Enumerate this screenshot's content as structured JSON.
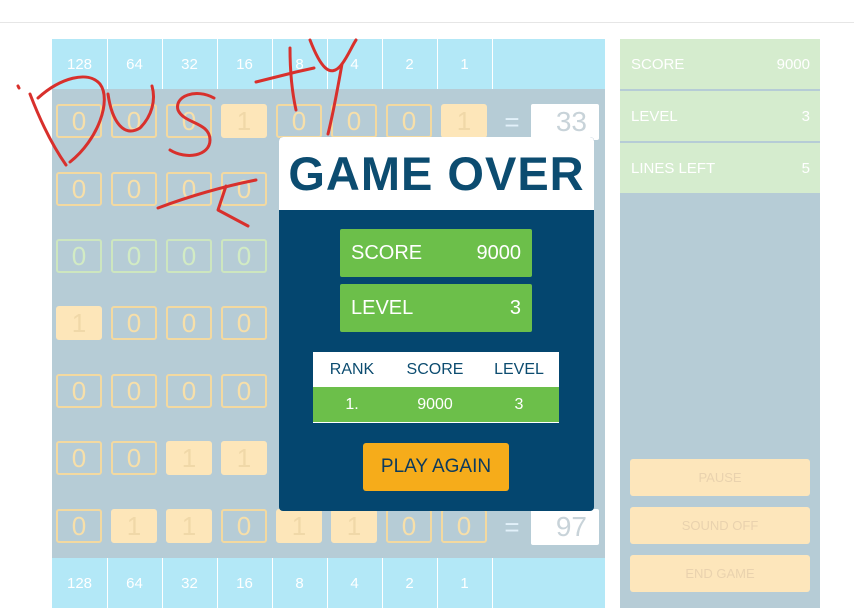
{
  "header_values": [
    "128",
    "64",
    "32",
    "16",
    "8",
    "4",
    "2",
    "1"
  ],
  "footer_values": [
    "128",
    "64",
    "32",
    "16",
    "8",
    "4",
    "2",
    "1"
  ],
  "rows": [
    {
      "bits": [
        "0",
        "0",
        "0",
        "1",
        "0",
        "0",
        "0",
        "1"
      ],
      "eq": "=",
      "answer": "33",
      "on": [
        3,
        7
      ]
    },
    {
      "bits": [
        "0",
        "0",
        "0",
        "0"
      ],
      "eq": "",
      "answer": "",
      "on": []
    },
    {
      "bits": [
        "0",
        "0",
        "0",
        "0"
      ],
      "eq": "",
      "answer": "",
      "on": []
    },
    {
      "bits": [
        "1",
        "0",
        "0",
        "0"
      ],
      "eq": "",
      "answer": "",
      "on": [
        0
      ]
    },
    {
      "bits": [
        "0",
        "0",
        "0",
        "0"
      ],
      "eq": "",
      "answer": "",
      "on": []
    },
    {
      "bits": [
        "0",
        "0",
        "1",
        "1"
      ],
      "eq": "",
      "answer": "",
      "on": [
        2,
        3
      ]
    },
    {
      "bits": [
        "0",
        "1",
        "1",
        "0",
        "1",
        "1",
        "0",
        "0"
      ],
      "eq": "=",
      "answer": "97",
      "on": [
        1,
        2,
        4,
        5
      ]
    }
  ],
  "sidebar": {
    "score_label": "SCORE",
    "score_value": "9000",
    "level_label": "LEVEL",
    "level_value": "3",
    "lines_label": "LINES LEFT",
    "lines_value": "5",
    "pause": "PAUSE",
    "sound": "SOUND OFF",
    "end": "END GAME"
  },
  "game_over": {
    "title": "GAME OVER",
    "score_label": "SCORE",
    "score_value": "9000",
    "level_label": "LEVEL",
    "level_value": "3",
    "table_headers": [
      "RANK",
      "SCORE",
      "LEVEL"
    ],
    "table_row": [
      "1.",
      "9000",
      "3"
    ],
    "play_again": "PLAY AGAIN"
  },
  "colors": {
    "accent_green": "#6cbf4a",
    "overlay_blue": "#04466f",
    "play_orange": "#f6ac1a",
    "header_blue": "#b3e8f7",
    "scribble_red": "#d8302c"
  }
}
